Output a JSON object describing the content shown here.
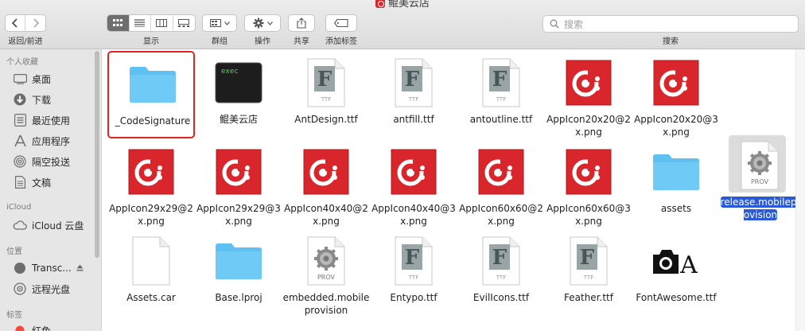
{
  "window": {
    "title": "鲲美云店"
  },
  "toolbar": {
    "nav_label": "返回/前进",
    "view_label": "显示",
    "group_label": "群组",
    "action_label": "操作",
    "share_label": "共享",
    "tag_label": "添加标签",
    "search_label": "搜索",
    "search_placeholder": "搜索"
  },
  "sidebar": {
    "favorites_header": "个人收藏",
    "favorites": [
      {
        "label": "桌面",
        "icon": "desktop-icon"
      },
      {
        "label": "下载",
        "icon": "download-icon"
      },
      {
        "label": "最近使用",
        "icon": "recents-icon"
      },
      {
        "label": "应用程序",
        "icon": "applications-icon"
      },
      {
        "label": "隔空投送",
        "icon": "airdrop-icon"
      },
      {
        "label": "文稿",
        "icon": "documents-icon"
      }
    ],
    "icloud_header": "iCloud",
    "icloud": [
      {
        "label": "iCloud 云盘",
        "icon": "cloud-icon"
      }
    ],
    "locations_header": "位置",
    "locations": [
      {
        "label": "Transc...",
        "icon": "disk-icon"
      },
      {
        "label": "远程光盘",
        "icon": "optical-disc-icon"
      }
    ],
    "tags_header": "标签",
    "tags": [
      {
        "label": "红色",
        "color": "#f24a3d"
      }
    ]
  },
  "files": [
    {
      "name": "_CodeSignature",
      "type": "folder"
    },
    {
      "name": "鲲美云店",
      "type": "exec",
      "badge": "exec"
    },
    {
      "name": "AntDesign.ttf",
      "type": "font",
      "badge": "TTF"
    },
    {
      "name": "antfill.ttf",
      "type": "font",
      "badge": "TTF"
    },
    {
      "name": "antoutline.ttf",
      "type": "font",
      "badge": "TTF"
    },
    {
      "name": "AppIcon20x20@2x.png",
      "type": "app"
    },
    {
      "name": "AppIcon20x20@3x.png",
      "type": "app"
    },
    {
      "name": "AppIcon29x29@2x.png",
      "type": "app"
    },
    {
      "name": "AppIcon29x29@3x.png",
      "type": "app"
    },
    {
      "name": "AppIcon40x40@2x.png",
      "type": "app"
    },
    {
      "name": "AppIcon40x40@3x.png",
      "type": "app"
    },
    {
      "name": "AppIcon60x60@2x.png",
      "type": "app"
    },
    {
      "name": "AppIcon60x60@3x.png",
      "type": "app"
    },
    {
      "name": "assets",
      "type": "folder"
    },
    {
      "name": "release.mobileprovision",
      "type": "prov",
      "badge": "PROV"
    },
    {
      "name": "Assets.car",
      "type": "doc"
    },
    {
      "name": "Base.lproj",
      "type": "folder"
    },
    {
      "name": "embedded.mobileprovision",
      "type": "prov",
      "badge": "PROV"
    },
    {
      "name": "Entypo.ttf",
      "type": "font",
      "badge": "TTF"
    },
    {
      "name": "EvilIcons.ttf",
      "type": "font",
      "badge": "TTF"
    },
    {
      "name": "Feather.ttf",
      "type": "font",
      "badge": "TTF"
    },
    {
      "name": "FontAwesome.ttf",
      "type": "fa"
    }
  ],
  "colors": {
    "accent": "#2a5ad7",
    "brand_red": "#d8262c",
    "folder": "#5ec1f2",
    "highlight": "#e0231f"
  }
}
